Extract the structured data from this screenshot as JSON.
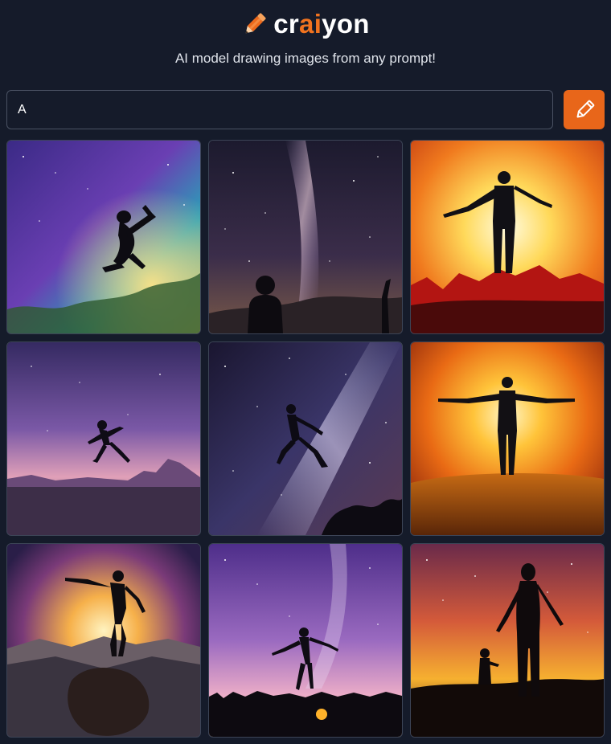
{
  "header": {
    "logo": {
      "prefix": "cr",
      "accent": "ai",
      "suffix": "yon"
    },
    "tagline": "AI model drawing images from any prompt!"
  },
  "prompt": {
    "value": "A",
    "placeholder": ""
  },
  "draw_button": {
    "icon": "pencil-icon"
  },
  "colors": {
    "background": "#151b2a",
    "accent": "#e8661a",
    "input_border": "#4a5263"
  },
  "gallery": {
    "count": 9,
    "images": [
      {
        "scene": "silhouette leaping through a colorful nebula"
      },
      {
        "scene": "person watching the milky way over hills"
      },
      {
        "scene": "figure with outstretched arms on red peak at sunset"
      },
      {
        "scene": "dancer leaping over a purple dusk landscape"
      },
      {
        "scene": "runner jumping across a starry sky"
      },
      {
        "scene": "figure with outstretched arms in golden sunrays over field"
      },
      {
        "scene": "person balancing on a rock before a glowing mountain horizon"
      },
      {
        "scene": "silhouette with spread arms on grass under purple sky"
      },
      {
        "scene": "woman and child silhouettes against a golden starry sky"
      }
    ]
  }
}
